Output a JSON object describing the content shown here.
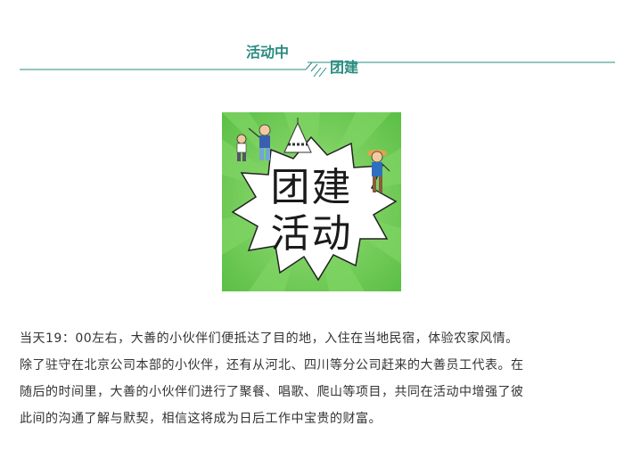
{
  "header": {
    "title_top": "活动中",
    "title_bottom": "团建",
    "accent_color": "#2a8c80"
  },
  "poster": {
    "line1": "团建",
    "line2": "活动",
    "background_color": "#6ecb58",
    "burst_color": "#ffffff",
    "illustration_icons": [
      "children-playing-illustration",
      "tent-illustration",
      "hiker-illustration"
    ]
  },
  "article": {
    "lines": [
      "当天19：00左右，大善的小伙伴们便抵达了目的地，入住在当地民宿，体验农家风情。",
      "除了驻守在北京公司本部的小伙伴，还有从河北、四川等分公司赶来的大善员工代表。在",
      "随后的时间里，大善的小伙伴们进行了聚餐、唱歌、爬山等项目，共同在活动中增强了彼",
      "此间的沟通了解与默契，相信这将成为日后工作中宝贵的财富。"
    ]
  }
}
